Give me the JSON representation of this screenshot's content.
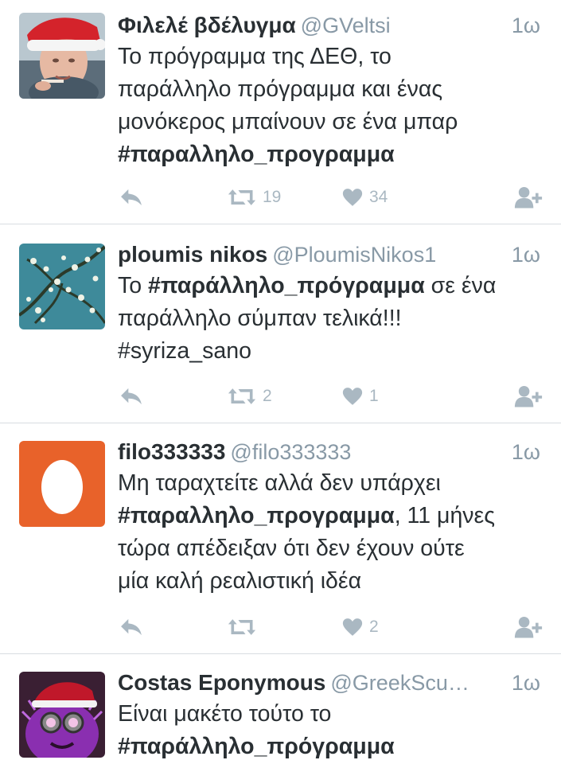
{
  "colors": {
    "text": "#292f33",
    "muted": "#8899a6",
    "icon": "#aab8c2",
    "divider": "#d8dde1",
    "egg_background": "#e8622a"
  },
  "tweets": [
    {
      "name": "Φιλελέ βδέλυγμα",
      "handle": "@GVeltsi",
      "time": "1ω",
      "lines": [
        [
          {
            "t": "Το πρόγραμμα της ΔΕΘ, το",
            "b": false
          }
        ],
        [
          {
            "t": "παράλληλο πρόγραμμα και ένας",
            "b": false
          }
        ],
        [
          {
            "t": "μονόκερος μπαίνουν σε ένα μπαρ",
            "b": false
          }
        ],
        [
          {
            "t": "#παραλληλο_προγραμμα",
            "b": true
          }
        ]
      ],
      "retweets": "19",
      "likes": "34",
      "avatar_icon": "santa-hat-avatar"
    },
    {
      "name": "ploumis nikos",
      "handle": "@PloumisNikos1",
      "time": "1ω",
      "lines": [
        [
          {
            "t": "Το ",
            "b": false
          },
          {
            "t": "#παράλληλο_πρόγραμμα",
            "b": true
          },
          {
            "t": " σε ένα",
            "b": false
          }
        ],
        [
          {
            "t": "παράλληλο σύμπαν τελικά!!!",
            "b": false
          }
        ],
        [
          {
            "t": "#syriza_sano",
            "b": false
          }
        ]
      ],
      "retweets": "2",
      "likes": "1",
      "avatar_icon": "almond-blossom-avatar"
    },
    {
      "name": "filo333333",
      "handle": "@filo333333",
      "time": "1ω",
      "lines": [
        [
          {
            "t": "Μη ταραχτείτε αλλά δεν υπάρχει",
            "b": false
          }
        ],
        [
          {
            "t": "#παραλληλο_προγραμμα",
            "b": true
          },
          {
            "t": ", 11 μήνες",
            "b": false
          }
        ],
        [
          {
            "t": "τώρα απέδειξαν ότι δεν έχουν ούτε",
            "b": false
          }
        ],
        [
          {
            "t": "μία καλή ρεαλιστική ιδέα",
            "b": false
          }
        ]
      ],
      "retweets": "",
      "likes": "2",
      "avatar_icon": "egg-avatar"
    },
    {
      "name": "Costas Eponymous",
      "handle": "@GreekScu…",
      "time": "1ω",
      "lines": [
        [
          {
            "t": "Είναι μακέτο τούτο το",
            "b": false
          }
        ],
        [
          {
            "t": "#παράλληλο_πρόγραμμα",
            "b": true
          }
        ]
      ],
      "retweets": "",
      "likes": "",
      "avatar_icon": "purple-minion-avatar"
    }
  ]
}
